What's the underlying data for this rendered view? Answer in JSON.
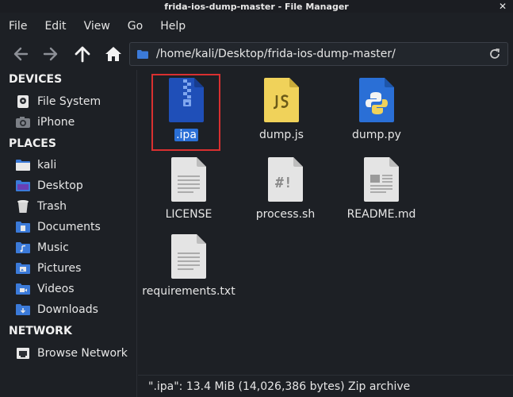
{
  "window": {
    "title": "frida-ios-dump-master - File Manager",
    "close_glyph": "✕"
  },
  "menu": [
    "File",
    "Edit",
    "View",
    "Go",
    "Help"
  ],
  "address": {
    "path": "/home/kali/Desktop/frida-ios-dump-master/"
  },
  "sidebar": {
    "devices_header": "DEVICES",
    "devices": [
      {
        "label": "File System",
        "icon": "drive-icon"
      },
      {
        "label": "iPhone",
        "icon": "camera-icon"
      }
    ],
    "places_header": "PLACES",
    "places": [
      {
        "label": "kali",
        "icon": "home-folder-icon"
      },
      {
        "label": "Desktop",
        "icon": "desktop-folder-icon"
      },
      {
        "label": "Trash",
        "icon": "trash-icon"
      },
      {
        "label": "Documents",
        "icon": "documents-folder-icon"
      },
      {
        "label": "Music",
        "icon": "music-folder-icon"
      },
      {
        "label": "Pictures",
        "icon": "pictures-folder-icon"
      },
      {
        "label": "Videos",
        "icon": "videos-folder-icon"
      },
      {
        "label": "Downloads",
        "icon": "downloads-folder-icon"
      }
    ],
    "network_header": "NETWORK",
    "network": [
      {
        "label": "Browse Network",
        "icon": "network-icon"
      }
    ]
  },
  "files": [
    {
      "name": ".ipa",
      "icon": "zip-archive-icon",
      "selected": true
    },
    {
      "name": "dump.js",
      "icon": "javascript-file-icon"
    },
    {
      "name": "dump.py",
      "icon": "python-file-icon"
    },
    {
      "name": "LICENSE",
      "icon": "text-file-icon"
    },
    {
      "name": "process.sh",
      "icon": "shell-script-icon"
    },
    {
      "name": "README.md",
      "icon": "markdown-file-icon"
    },
    {
      "name": "requirements.txt",
      "icon": "text-file-icon"
    }
  ],
  "status": {
    "text": "\".ipa\": 13.4 MiB (14,026,386 bytes) Zip archive"
  },
  "colors": {
    "accent": "#2a6fd6",
    "selection_outline": "#d93030",
    "folder_blue": "#3b7ad9"
  }
}
